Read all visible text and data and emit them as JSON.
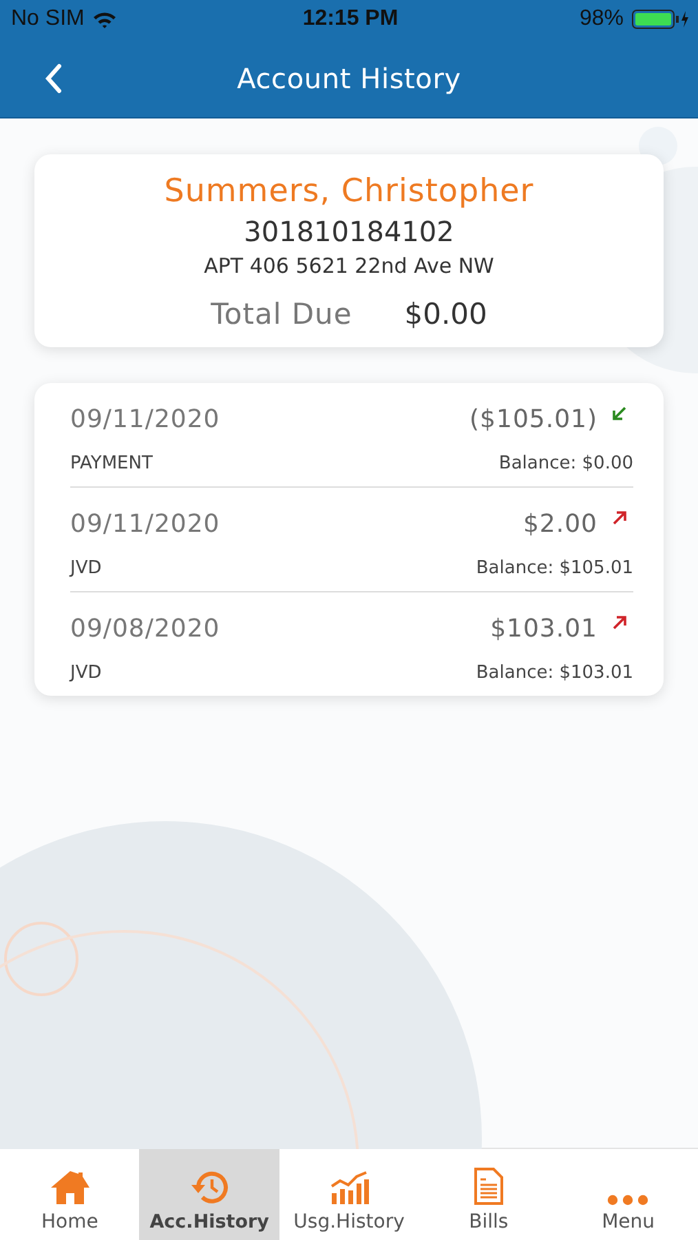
{
  "status_bar": {
    "carrier": "No SIM",
    "time": "12:15 PM",
    "battery": "98%"
  },
  "header": {
    "title": "Account History"
  },
  "account": {
    "name": "Summers, Christopher",
    "number": "301810184102",
    "address": "APT 406 5621 22nd Ave NW",
    "total_label": "Total Due",
    "total_value": "$0.00"
  },
  "transactions": [
    {
      "date": "09/11/2020",
      "amount": "($105.01)",
      "kind": "credit",
      "type": "PAYMENT",
      "balance": "Balance: $0.00"
    },
    {
      "date": "09/11/2020",
      "amount": "$2.00",
      "kind": "debit",
      "type": "JVD",
      "balance": "Balance: $105.01"
    },
    {
      "date": "09/08/2020",
      "amount": "$103.01",
      "kind": "debit",
      "type": "JVD",
      "balance": "Balance: $103.01"
    }
  ],
  "tabs": [
    {
      "label": "Home",
      "kind": "home",
      "selected": false
    },
    {
      "label": "Acc.History",
      "kind": "history",
      "selected": true
    },
    {
      "label": "Usg.History",
      "kind": "usage",
      "selected": false
    },
    {
      "label": "Bills",
      "kind": "bills",
      "selected": false
    },
    {
      "label": "Menu",
      "kind": "menu",
      "selected": false
    }
  ]
}
